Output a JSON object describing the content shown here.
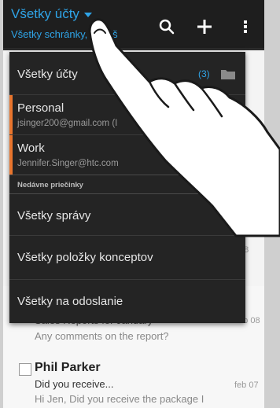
{
  "action_bar": {
    "title": "Všetky účty",
    "subtitle": "Všetky schránky, č. poš",
    "icons": [
      "search-icon",
      "add-icon",
      "overflow-menu-icon"
    ]
  },
  "dropdown": {
    "all_accounts": {
      "label": "Všetky účty",
      "count": "(3)",
      "icon": "folder-icon"
    },
    "accounts": [
      {
        "name": "Personal",
        "email": "jsinger200@gmail.com (I"
      },
      {
        "name": "Work",
        "email": "Jennifer.Singer@htc.com"
      }
    ],
    "recent_section": "Nedávne priečinky",
    "folders": [
      {
        "label": "Všetky správy"
      },
      {
        "label": "Všetky položky konceptov"
      },
      {
        "label": "Všetky na odoslanie"
      }
    ]
  },
  "background_emails": [
    {
      "subject": "Sales Reports for January",
      "preview": "Any comments on the report?",
      "date": "feb 08"
    },
    {
      "sender": "Phil Parker",
      "subject": "Did you receive...",
      "preview": "Hi Jen, Did you receive the package I",
      "date": "feb 07"
    }
  ],
  "colors": {
    "accent": "#2fa4e7",
    "account_marker": "#e9752d",
    "action_bar": "#1e1e1e",
    "dropdown": "#242424"
  }
}
